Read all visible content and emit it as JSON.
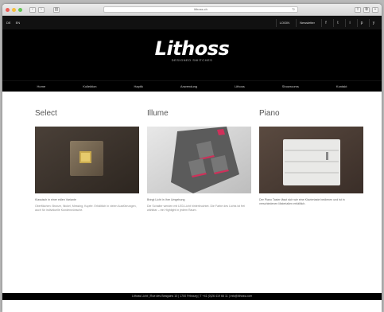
{
  "browser": {
    "address": "lithoss.ch",
    "reload_icon": "reload-icon",
    "nav": {
      "back": "‹",
      "forward": "›"
    }
  },
  "topbar": {
    "languages": [
      "DE",
      "EN"
    ],
    "login": "LOGIN",
    "newsletter": "Newsletter",
    "social": [
      "f",
      "t",
      "i",
      "p",
      "y"
    ]
  },
  "header": {
    "logo": "Lithoss",
    "tagline": "DESIGNED SWITCHES"
  },
  "mainnav": {
    "items": [
      "Home",
      "Kollektion",
      "Haptik",
      "Anwendung",
      "Lithoss",
      "Showrooms",
      "Kontakt"
    ]
  },
  "products": [
    {
      "title": "Select",
      "caption": "Klassisch in einer edlen Variante",
      "desc": "Oberflächen: Bronze, Nickel, Messing, Kupfer. Erhältlich in vielen Ausführungen, auch für individuelle Kundenwünsche."
    },
    {
      "title": "Illume",
      "caption": "Bringt Licht in Ihre Umgebung",
      "desc": "Die Schalter werden mit LED-Licht hinterleuchtet. Die Farbe des Lichts ist frei wählbar – ein Highlight in jedem Raum."
    },
    {
      "title": "Piano",
      "caption": "Der Piano Taster lässt sich wie eine Klaviertaste bedienen und ist in verschiedenen Materialien erhältlich.",
      "desc": ""
    }
  ],
  "footer": {
    "text": "Lithoss Licht | Rue des Beaguins 10 | 1700 Fribourg | T +41 (0)26 419 66 11 | info@lithoss.com"
  },
  "colors": {
    "accent_red": "#d0305a",
    "header_bg": "#000000",
    "page_bg": "#ffffff"
  }
}
